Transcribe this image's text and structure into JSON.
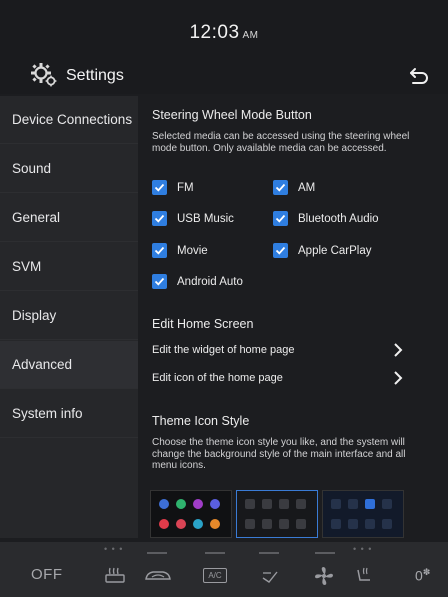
{
  "status_bar": {
    "time": "12:03",
    "ampm": "AM"
  },
  "header": {
    "title": "Settings",
    "settings_icon": "gear-icon",
    "back_icon": "back-arrow-icon"
  },
  "sidebar": {
    "items": [
      {
        "label": "Device Connections"
      },
      {
        "label": "Sound"
      },
      {
        "label": "General"
      },
      {
        "label": "SVM"
      },
      {
        "label": "Display"
      },
      {
        "label": "Advanced"
      },
      {
        "label": "System info"
      }
    ],
    "active": "Advanced"
  },
  "steering": {
    "title": "Steering Wheel Mode Button",
    "description": "Selected media can be accessed using the steering wheel mode button. Only available media can be accessed.",
    "options": [
      {
        "label": "FM",
        "checked": true
      },
      {
        "label": "AM",
        "checked": true
      },
      {
        "label": "USB Music",
        "checked": true
      },
      {
        "label": "Bluetooth Audio",
        "checked": true
      },
      {
        "label": "Movie",
        "checked": true
      },
      {
        "label": "Apple CarPlay",
        "checked": true
      },
      {
        "label": "Android Auto",
        "checked": true
      }
    ]
  },
  "home_screen": {
    "title": "Edit Home Screen",
    "rows": [
      {
        "label": "Edit the widget of home page"
      },
      {
        "label": "Edit icon of the home page"
      }
    ]
  },
  "theme": {
    "title": "Theme Icon Style",
    "description": "Choose the theme icon style you like, and the system will change the background style of the main interface and all menu icons."
  },
  "climate": {
    "fan_status": "OFF",
    "temperature": "0",
    "icons": [
      "rear-defrost-icon",
      "recirculation-icon",
      "ac-icon",
      "air-direction-icon",
      "fan-icon",
      "seat-heat-icon"
    ],
    "ac_label": "A/C"
  },
  "colors": {
    "accent": "#2f7ee0",
    "background": "#1c1d20",
    "sidebar": "#26272a"
  }
}
